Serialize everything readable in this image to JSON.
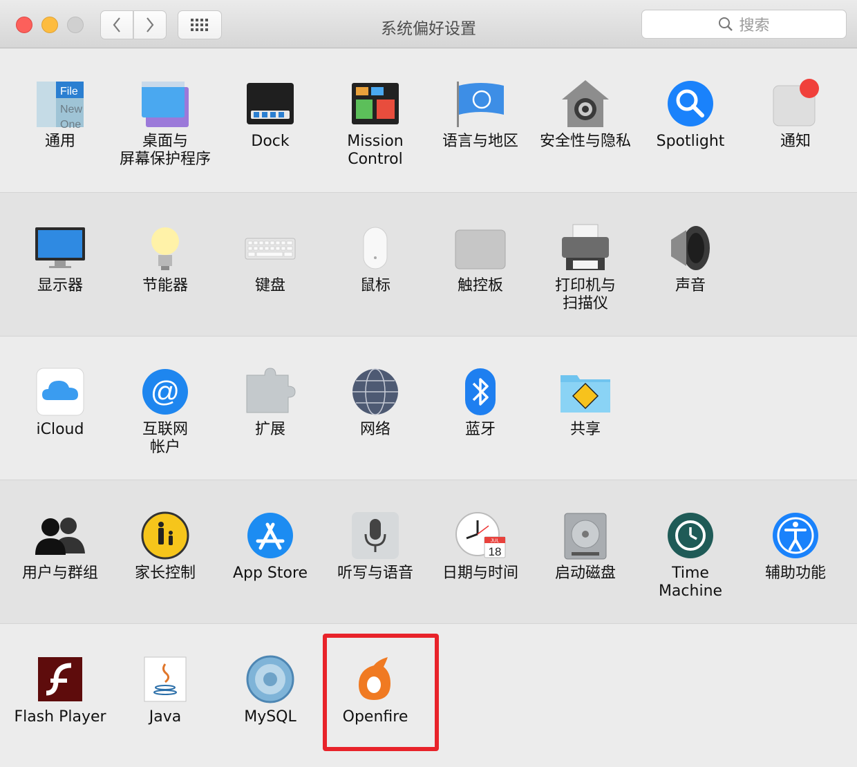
{
  "window": {
    "title": "系统偏好设置"
  },
  "toolbar": {
    "search_placeholder": "搜索"
  },
  "rows": [
    [
      {
        "label": "通用",
        "icon": "general-icon"
      },
      {
        "label": "桌面与\n屏幕保护程序",
        "icon": "desktop-icon"
      },
      {
        "label": "Dock",
        "icon": "dock-icon"
      },
      {
        "label": "Mission\nControl",
        "icon": "mission-control-icon"
      },
      {
        "label": "语言与地区",
        "icon": "language-region-icon"
      },
      {
        "label": "安全性与隐私",
        "icon": "security-privacy-icon"
      },
      {
        "label": "Spotlight",
        "icon": "spotlight-icon"
      },
      {
        "label": "通知",
        "icon": "notifications-icon"
      }
    ],
    [
      {
        "label": "显示器",
        "icon": "displays-icon"
      },
      {
        "label": "节能器",
        "icon": "energy-saver-icon"
      },
      {
        "label": "键盘",
        "icon": "keyboard-icon"
      },
      {
        "label": "鼠标",
        "icon": "mouse-icon"
      },
      {
        "label": "触控板",
        "icon": "trackpad-icon"
      },
      {
        "label": "打印机与\n扫描仪",
        "icon": "printers-scanners-icon"
      },
      {
        "label": "声音",
        "icon": "sound-icon"
      }
    ],
    [
      {
        "label": "iCloud",
        "icon": "icloud-icon"
      },
      {
        "label": "互联网\n帐户",
        "icon": "internet-accounts-icon"
      },
      {
        "label": "扩展",
        "icon": "extensions-icon"
      },
      {
        "label": "网络",
        "icon": "network-icon"
      },
      {
        "label": "蓝牙",
        "icon": "bluetooth-icon"
      },
      {
        "label": "共享",
        "icon": "sharing-icon"
      }
    ],
    [
      {
        "label": "用户与群组",
        "icon": "users-groups-icon"
      },
      {
        "label": "家长控制",
        "icon": "parental-controls-icon"
      },
      {
        "label": "App Store",
        "icon": "app-store-icon"
      },
      {
        "label": "听写与语音",
        "icon": "dictation-speech-icon"
      },
      {
        "label": "日期与时间",
        "icon": "date-time-icon"
      },
      {
        "label": "启动磁盘",
        "icon": "startup-disk-icon"
      },
      {
        "label": "Time Machine",
        "icon": "time-machine-icon"
      },
      {
        "label": "辅助功能",
        "icon": "accessibility-icon"
      }
    ],
    [
      {
        "label": "Flash Player",
        "icon": "flash-player-icon"
      },
      {
        "label": "Java",
        "icon": "java-icon"
      },
      {
        "label": "MySQL",
        "icon": "mysql-icon"
      },
      {
        "label": "Openfire",
        "icon": "openfire-icon"
      }
    ]
  ],
  "icon_text": {
    "general_file": "File",
    "general_new": "New",
    "general_one": "One",
    "calendar_month": "JUL",
    "calendar_day": "18"
  },
  "colors": {
    "highlight": "#e8232a",
    "accent_blue": "#1a82fb"
  }
}
